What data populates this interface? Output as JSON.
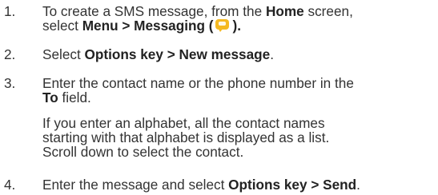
{
  "steps": [
    {
      "number": "1.",
      "line1_prefix": "To create a SMS message, from the ",
      "line1_bold": "Home",
      "line1_suffix": " screen,",
      "line2_prefix": "select ",
      "line2_bold": "Menu > Messaging (",
      "icon": "messaging-app-icon",
      "line2_bold_end": ")."
    },
    {
      "number": "2.",
      "prefix": "Select ",
      "bold": "Options key > New message",
      "suffix": "."
    },
    {
      "number": "3.",
      "line1": "Enter the contact name or the phone number in the",
      "line2_bold": "To",
      "line2_suffix": " field.",
      "note_lines": [
        "If you enter an alphabet, all the contact names",
        "starting with that alphabet is displayed as a list.",
        "Scroll down to select the contact."
      ]
    },
    {
      "number": "4.",
      "prefix": "Enter the message and select ",
      "bold": "Options key > Send",
      "suffix": "."
    }
  ],
  "colors": {
    "text": "#333333",
    "icon": "#f5b921"
  }
}
